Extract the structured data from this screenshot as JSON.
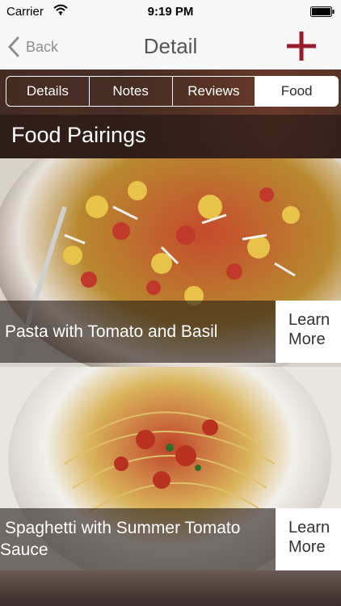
{
  "status_bar": {
    "carrier": "Carrier",
    "time": "9:19 PM"
  },
  "nav": {
    "back_label": "Back",
    "title": "Detail"
  },
  "tabs": [
    {
      "label": "Details",
      "active": false
    },
    {
      "label": "Notes",
      "active": false
    },
    {
      "label": "Reviews",
      "active": false
    },
    {
      "label": "Food",
      "active": true
    }
  ],
  "section": {
    "title": "Food Pairings"
  },
  "pairings": [
    {
      "name": "Pasta with Tomato and Basil",
      "action": "Learn More"
    },
    {
      "name": "Spaghetti with Summer Tomato Sauce",
      "action": "Learn More"
    }
  ],
  "colors": {
    "accent": "#9b1b2e",
    "nav_text": "#8e8e93"
  }
}
